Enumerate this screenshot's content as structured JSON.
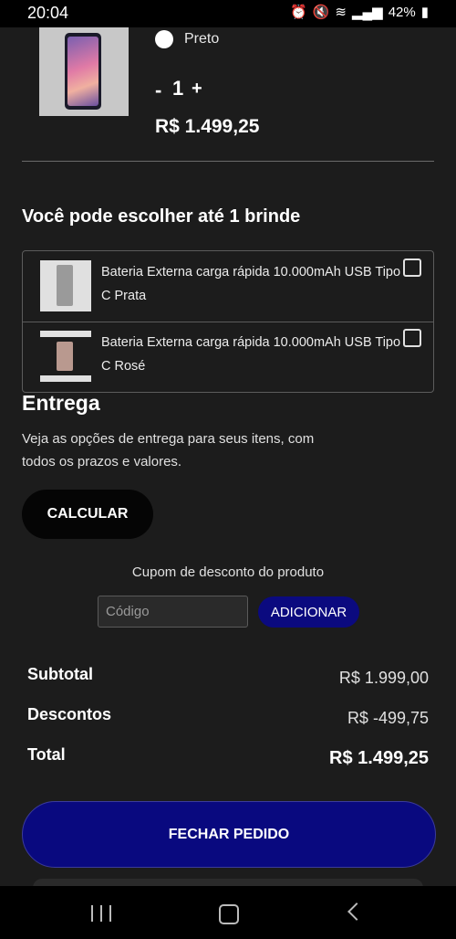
{
  "status_bar": {
    "time": "20:04",
    "battery": "42%"
  },
  "product": {
    "color": "Preto",
    "quantity": "1",
    "minus_label": "-",
    "plus_label": "+",
    "price": "R$ 1.499,25"
  },
  "gifts": {
    "title": "Você pode escolher até 1 brinde",
    "items": [
      {
        "name": "Bateria Externa carga rápida 10.000mAh USB Tipo C Prata",
        "checked": false
      },
      {
        "name": "Bateria Externa carga rápida 10.000mAh USB Tipo C Rosé",
        "checked": false
      }
    ]
  },
  "delivery": {
    "title": "Entrega",
    "description": "Veja as opções de entrega para seus itens, com todos os prazos e valores.",
    "calculate_label": "CALCULAR"
  },
  "coupon": {
    "label": "Cupom de desconto do produto",
    "placeholder": "Código",
    "add_label": "ADICIONAR"
  },
  "summary": {
    "subtotal_label": "Subtotal",
    "subtotal_value": "R$ 1.999,00",
    "discount_label": "Descontos",
    "discount_value": "R$ -499,75",
    "total_label": "Total",
    "total_value": "R$ 1.499,25"
  },
  "checkout_label": "FECHAR PEDIDO",
  "colors": {
    "background": "#1c1c1c",
    "primary_button": "#09097f",
    "calculate_button": "#050505"
  }
}
